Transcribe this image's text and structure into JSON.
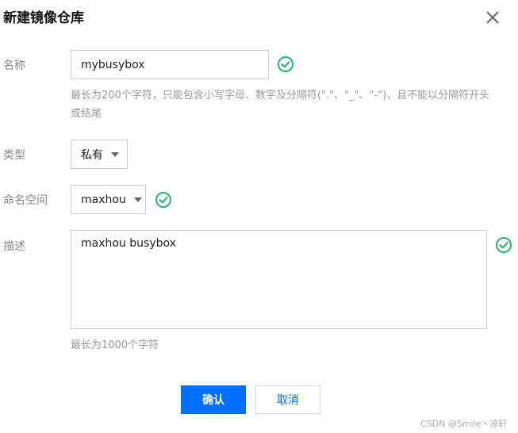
{
  "dialog": {
    "title": "新建镜像仓库",
    "close_icon": "close-icon"
  },
  "form": {
    "name": {
      "label": "名称",
      "value": "mybusybox",
      "hint": "最长为200个字符，只能包含小写字母、数字及分隔符(\".\"、\"_\"、\"-\")，且不能以分隔符开头或结尾",
      "status_icon": "check-circle-icon"
    },
    "type": {
      "label": "类型",
      "value": "私有"
    },
    "namespace": {
      "label": "命名空间",
      "value": "maxhou",
      "status_icon": "check-circle-icon"
    },
    "description": {
      "label": "描述",
      "value": "maxhou busybox",
      "hint": "最长为1000个字符",
      "status_icon": "check-circle-icon"
    }
  },
  "buttons": {
    "confirm": "确认",
    "cancel": "取消"
  },
  "watermark": "CSDN @Smile丶凉轩",
  "colors": {
    "primary": "#006eff",
    "success": "#29b36b"
  }
}
